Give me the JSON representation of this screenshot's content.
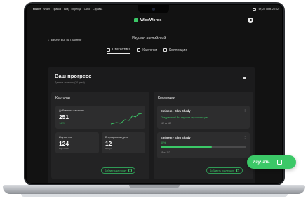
{
  "menubar": {
    "items": [
      "Finder",
      "Файл",
      "Правка",
      "Вид",
      "Переход",
      "Окно",
      "Справка"
    ],
    "clock": "Вт, 20 фев. 20:02"
  },
  "app": {
    "name": "WiseWords"
  },
  "nav": {
    "back_label": "Вернуться на главную",
    "subject": "Изучаю английский",
    "tabs": [
      {
        "label": "Статистика",
        "active": true
      },
      {
        "label": "Карточки",
        "active": false
      },
      {
        "label": "Коллекции",
        "active": false
      }
    ]
  },
  "progress": {
    "title": "Ваш прогресс",
    "subtitle": "Данные за месяц (30 дней)",
    "cards": {
      "title": "Карточки",
      "added_label": "Добавлено карточек",
      "added_value": "251",
      "added_delta": "+42%",
      "learning_label": "Изучается",
      "learning_value": "124",
      "learning_unit": "карточки",
      "avg_label": "В среднем за день",
      "avg_value": "12",
      "avg_unit": "минут",
      "add_button": "Добавить карточку"
    },
    "collections": {
      "title": "Коллекции",
      "items": [
        {
          "title": "Eminem - Slim Shady",
          "status": "Поздравляю! Вы изучили эту коллекцию",
          "count": "112 из 112"
        },
        {
          "title": "Eminem - Slim Shady",
          "percent": "60%",
          "progress": 0.6,
          "count": "65 из 112"
        }
      ],
      "add_button": "Добавить коллекцию"
    }
  },
  "fab": {
    "label": "Изучать"
  },
  "colors": {
    "accent": "#3bc867",
    "background": "#121212",
    "panel": "#1b1b1c"
  }
}
